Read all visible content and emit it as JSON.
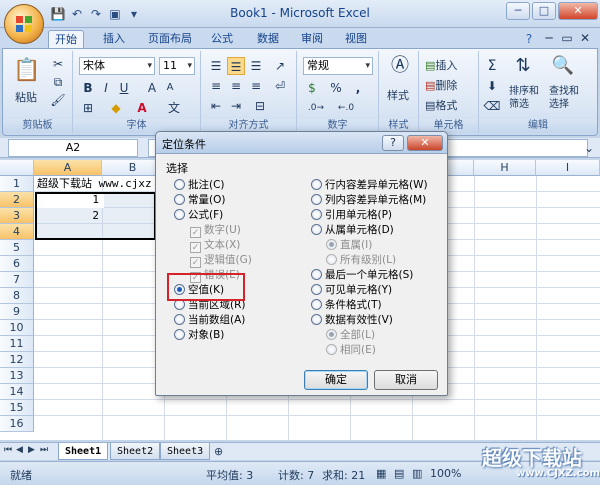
{
  "window": {
    "title": "Book1 - Microsoft Excel",
    "min": "─",
    "max": "□",
    "close": "✕"
  },
  "tabs": [
    "开始",
    "插入",
    "页面布局",
    "公式",
    "数据",
    "审阅",
    "视图"
  ],
  "ribbon": {
    "groups": [
      "剪贴板",
      "字体",
      "对齐方式",
      "数字",
      "样式",
      "单元格",
      "编辑"
    ],
    "paste": "粘贴",
    "font_name": "宋体",
    "font_size": "11",
    "bold": "B",
    "italic": "I",
    "underline": "U",
    "number_format": "常规",
    "percent": "%",
    "comma": ",",
    "styles": "样式",
    "insert": "插入",
    "delete": "删除",
    "format": "格式",
    "sort_filter": "排序和筛选",
    "find_select": "查找和选择"
  },
  "formula_bar": {
    "name_box": "A2"
  },
  "sheet": {
    "columns": [
      "A",
      "B",
      "C",
      "D",
      "E",
      "F",
      "G",
      "H",
      "I"
    ],
    "rows": [
      "1",
      "2",
      "3",
      "4",
      "5",
      "6",
      "7",
      "8",
      "9",
      "10",
      "11",
      "12",
      "13",
      "14",
      "15",
      "16"
    ],
    "a1": "超级下载站 www.cjxz",
    "a2": "1",
    "a3": "2"
  },
  "dialog": {
    "title": "定位条件",
    "help": "?",
    "close": "✕",
    "section": "选择",
    "left_options": [
      "批注(C)",
      "常量(O)",
      "公式(F)",
      "数字(U)",
      "文本(X)",
      "逻辑值(G)",
      "错误(E)",
      "空值(K)",
      "当前区域(R)",
      "当前数组(A)",
      "对象(B)"
    ],
    "right_options": [
      "行内容差异单元格(W)",
      "列内容差异单元格(M)",
      "引用单元格(P)",
      "从属单元格(D)",
      "直属(I)",
      "所有级别(L)",
      "最后一个单元格(S)",
      "可见单元格(Y)",
      "条件格式(T)",
      "数据有效性(V)",
      "全部(L)",
      "相同(E)"
    ],
    "ok": "确定",
    "cancel": "取消"
  },
  "sheet_tabs": [
    "Sheet1",
    "Sheet2",
    "Sheet3"
  ],
  "status": {
    "mode": "就绪",
    "average": "平均值: 3",
    "count": "计数: 7",
    "sum": "求和: 21",
    "zoom": "100%"
  },
  "watermark": {
    "title": "超级下载站",
    "url": "www.CJXZ.com"
  },
  "colors": {
    "highlight": "#d4232a",
    "ribbon": "#dbe6f4"
  }
}
